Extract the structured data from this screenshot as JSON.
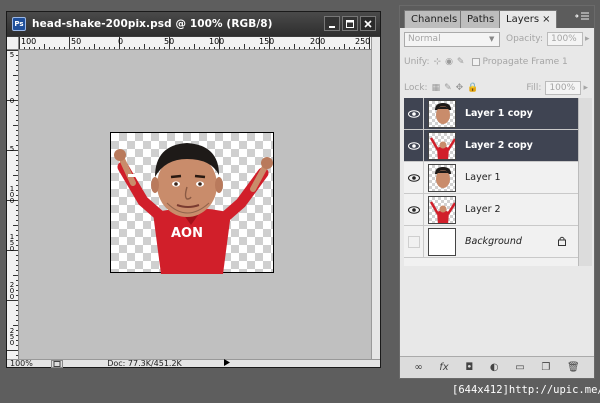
{
  "document": {
    "title": "head-shake-200pix.psd @ 100% (RGB/8)",
    "app_badge": "Ps",
    "ruler_top": [
      "100",
      "50",
      "0",
      "50",
      "100",
      "150",
      "200",
      "250"
    ],
    "ruler_left": [
      "5",
      "0",
      "5",
      "1 0 0",
      "1 5 0",
      "2 0 0",
      "2 5 0"
    ],
    "zoom": "100%",
    "doc_size": "Doc: 77.3K/451.2K"
  },
  "panel": {
    "tabs": [
      "Channels",
      "Paths",
      "Layers"
    ],
    "active_tab": "Layers",
    "blend_mode": "Normal",
    "opacity_label": "Opacity:",
    "opacity_value": "100%",
    "unify_label": "Unify:",
    "propagate_label": "Propagate Frame 1",
    "lock_label": "Lock:",
    "fill_label": "Fill:",
    "fill_value": "100%",
    "layers": [
      {
        "name": "Layer 1 copy",
        "selected": true,
        "visible": true,
        "thumb": "head"
      },
      {
        "name": "Layer 2 copy",
        "selected": true,
        "visible": true,
        "thumb": "body"
      },
      {
        "name": "Layer 1",
        "selected": false,
        "visible": true,
        "thumb": "head"
      },
      {
        "name": "Layer 2",
        "selected": false,
        "visible": true,
        "thumb": "body"
      },
      {
        "name": "Background",
        "selected": false,
        "visible": false,
        "thumb": "white",
        "locked": true
      }
    ]
  },
  "watermark": "[644x412]http://upic.me/",
  "colors": {
    "selection": "#3f4452",
    "canvas": "#c0c0c0",
    "jersey": "#d11f2a"
  }
}
